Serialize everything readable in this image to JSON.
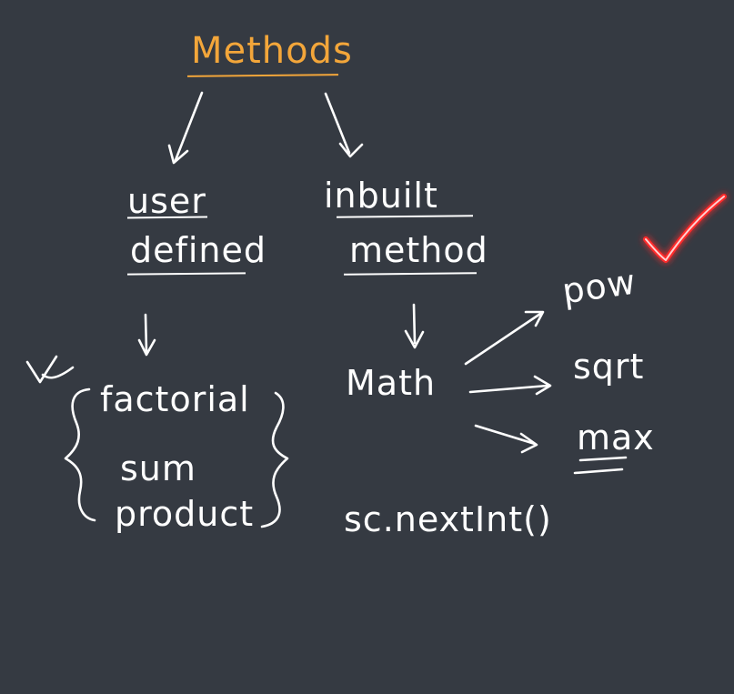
{
  "title": "Methods",
  "branches": {
    "user_defined": {
      "line1": "user",
      "line2": "defined"
    },
    "inbuilt": {
      "line1": "inbuilt",
      "line2": "method"
    }
  },
  "user_defined_examples": [
    "factorial",
    "sum",
    "product"
  ],
  "inbuilt_class": "Math",
  "math_methods": [
    "pow",
    "sqrt",
    "max"
  ],
  "scanner_call": "sc.nextInt()",
  "colors": {
    "board": "#353a42",
    "ink": "#ffffff",
    "title": "#f3a63a",
    "checkmark": "#ff2a2a"
  }
}
